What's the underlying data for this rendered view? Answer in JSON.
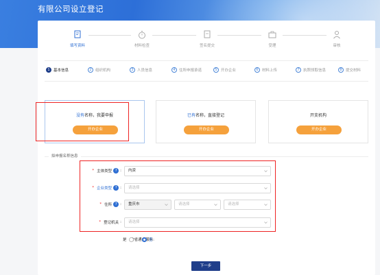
{
  "page": {
    "title": "有限公司设立登记"
  },
  "steps": [
    {
      "label": "填写资料",
      "icon": "document-edit-icon",
      "active": true
    },
    {
      "label": "材料检查",
      "icon": "stopwatch-icon",
      "active": false
    },
    {
      "label": "签名提交",
      "icon": "signature-doc-icon",
      "active": false
    },
    {
      "label": "受理",
      "icon": "briefcase-icon",
      "active": false
    },
    {
      "label": "审核",
      "icon": "user-check-icon",
      "active": false
    }
  ],
  "substeps": [
    {
      "num": "1",
      "label": "基本信息",
      "active": true
    },
    {
      "num": "2",
      "label": "组织机构"
    },
    {
      "num": "3",
      "label": "人员信息"
    },
    {
      "num": "4",
      "label": "住所申报承诺"
    },
    {
      "num": "5",
      "label": "开办企业"
    },
    {
      "num": "6",
      "label": "材料上传"
    },
    {
      "num": "7",
      "label": "执照领取信息"
    },
    {
      "num": "8",
      "label": "提交材料"
    }
  ],
  "options": [
    {
      "prefix": "没有",
      "suffix": "名称，我要申报",
      "button": "开办企业"
    },
    {
      "prefix": "已有",
      "suffix": "名称，直接登记",
      "button": "开办企业"
    },
    {
      "prefix": "",
      "suffix": "开支机构",
      "button": "开办企业"
    }
  ],
  "section": {
    "title": "拟申报名称信息"
  },
  "form": {
    "subject_type": {
      "label": "主体类型",
      "value": "内资"
    },
    "enterprise_type": {
      "label": "企业类型",
      "placeholder": "请选择"
    },
    "address": {
      "label": "住所",
      "city": "重庆市",
      "district_placeholder": "请选择",
      "street_placeholder": "请选择"
    },
    "registry": {
      "label": "登记机关",
      "placeholder": "请选择"
    },
    "remote": {
      "label": "跨省通办服务",
      "yes": "是",
      "no": "否",
      "selected": "no"
    }
  },
  "actions": {
    "next": "下一步"
  },
  "colors": {
    "primary": "#1f3e8a",
    "accent": "#f5a13c",
    "link": "#2f6fd3",
    "highlight": "#e22222"
  }
}
